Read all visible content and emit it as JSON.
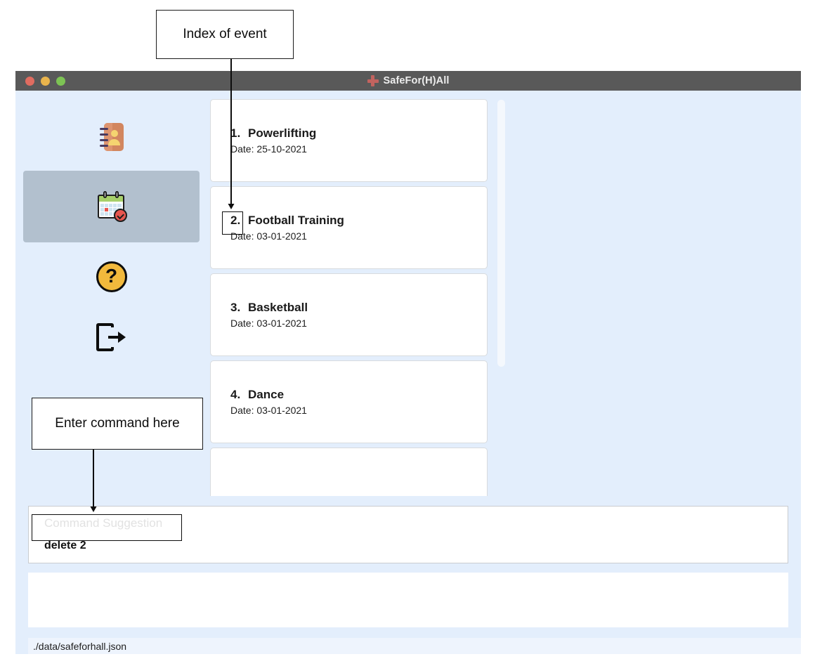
{
  "window": {
    "title": "SafeFor(H)All",
    "title_icon": "plus-cross-icon",
    "traffic_lights": [
      "close-red",
      "minimize-yellow",
      "maximize-green"
    ]
  },
  "sidebar": {
    "items": [
      {
        "name": "contacts",
        "icon": "contact-book-icon",
        "selected": false
      },
      {
        "name": "events",
        "icon": "calendar-check-icon",
        "selected": true
      },
      {
        "name": "help",
        "icon": "question-mark-icon",
        "selected": false
      },
      {
        "name": "logout",
        "icon": "logout-arrow-icon",
        "selected": false
      }
    ]
  },
  "event_list": {
    "date_label_prefix": "Date: ",
    "events": [
      {
        "index": "1.",
        "title": "Powerlifting",
        "date": "Date: 25-10-2021"
      },
      {
        "index": "2.",
        "title": "Football Training",
        "date": "Date: 03-01-2021"
      },
      {
        "index": "3.",
        "title": "Basketball",
        "date": "Date: 03-01-2021"
      },
      {
        "index": "4.",
        "title": "Dance",
        "date": "Date: 03-01-2021"
      }
    ],
    "scrollbar": "vertical-scrollbar"
  },
  "command": {
    "suggestion_label": "Command Suggestion",
    "input_value": "delete 2",
    "input_placeholder": "Enter command here"
  },
  "result": {
    "text": ""
  },
  "status": {
    "path": "./data/safeforhall.json"
  },
  "annotations": {
    "index_callout": "Index of event",
    "command_callout": "Enter command here"
  },
  "colors": {
    "app_background": "#e3eefc",
    "title_bar": "#595959",
    "selected_nav": "#b2c0ce",
    "card_background": "#ffffff",
    "accent_red": "#c2635f",
    "status_bar": "#eef4fd"
  }
}
